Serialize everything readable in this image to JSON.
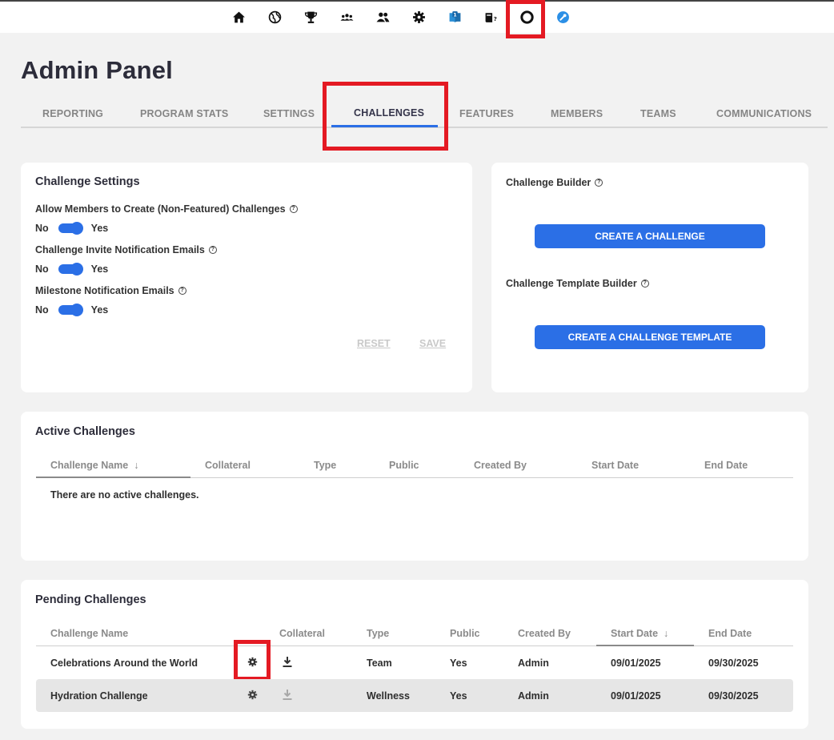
{
  "nav": {
    "icons": [
      "home-icon",
      "globe-icon",
      "trophy-icon",
      "group-icon",
      "members-icon",
      "gear-icon",
      "book-icon",
      "help-book-icon",
      "lifebuoy-icon",
      "wrench-icon"
    ]
  },
  "page_title": "Admin Panel",
  "tabs": [
    {
      "label": "REPORTING"
    },
    {
      "label": "PROGRAM STATS"
    },
    {
      "label": "SETTINGS"
    },
    {
      "label": "CHALLENGES",
      "active": true
    },
    {
      "label": "FEATURES"
    },
    {
      "label": "MEMBERS"
    },
    {
      "label": "TEAMS"
    },
    {
      "label": "COMMUNICATIONS"
    }
  ],
  "challenge_settings": {
    "title": "Challenge Settings",
    "settings": [
      {
        "label": "Allow Members to Create (Non-Featured) Challenges",
        "off": "No",
        "on": "Yes",
        "value": true
      },
      {
        "label": "Challenge Invite Notification Emails",
        "off": "No",
        "on": "Yes",
        "value": true
      },
      {
        "label": "Milestone Notification Emails",
        "off": "No",
        "on": "Yes",
        "value": true
      }
    ],
    "reset_label": "RESET",
    "save_label": "SAVE"
  },
  "builder": {
    "challenge_builder_label": "Challenge Builder",
    "create_challenge_label": "CREATE A CHALLENGE",
    "template_builder_label": "Challenge Template Builder",
    "create_template_label": "CREATE A CHALLENGE TEMPLATE"
  },
  "active": {
    "title": "Active Challenges",
    "columns": [
      "Challenge Name",
      "Collateral",
      "Type",
      "Public",
      "Created By",
      "Start Date",
      "End Date"
    ],
    "sort_indicator": "↓",
    "empty_message": "There are no active challenges."
  },
  "pending": {
    "title": "Pending Challenges",
    "columns": [
      "Challenge Name",
      "Collateral",
      "Type",
      "Public",
      "Created By",
      "Start Date",
      "End Date"
    ],
    "sort_indicator": "↓",
    "rows": [
      {
        "name": "Celebrations Around the World",
        "type": "Team",
        "public": "Yes",
        "created_by": "Admin",
        "start": "09/01/2025",
        "end": "09/30/2025"
      },
      {
        "name": "Hydration Challenge",
        "type": "Wellness",
        "public": "Yes",
        "created_by": "Admin",
        "start": "09/01/2025",
        "end": "09/30/2025"
      }
    ]
  },
  "colors": {
    "accent": "#2b6fe6",
    "highlight": "#e41a23"
  }
}
